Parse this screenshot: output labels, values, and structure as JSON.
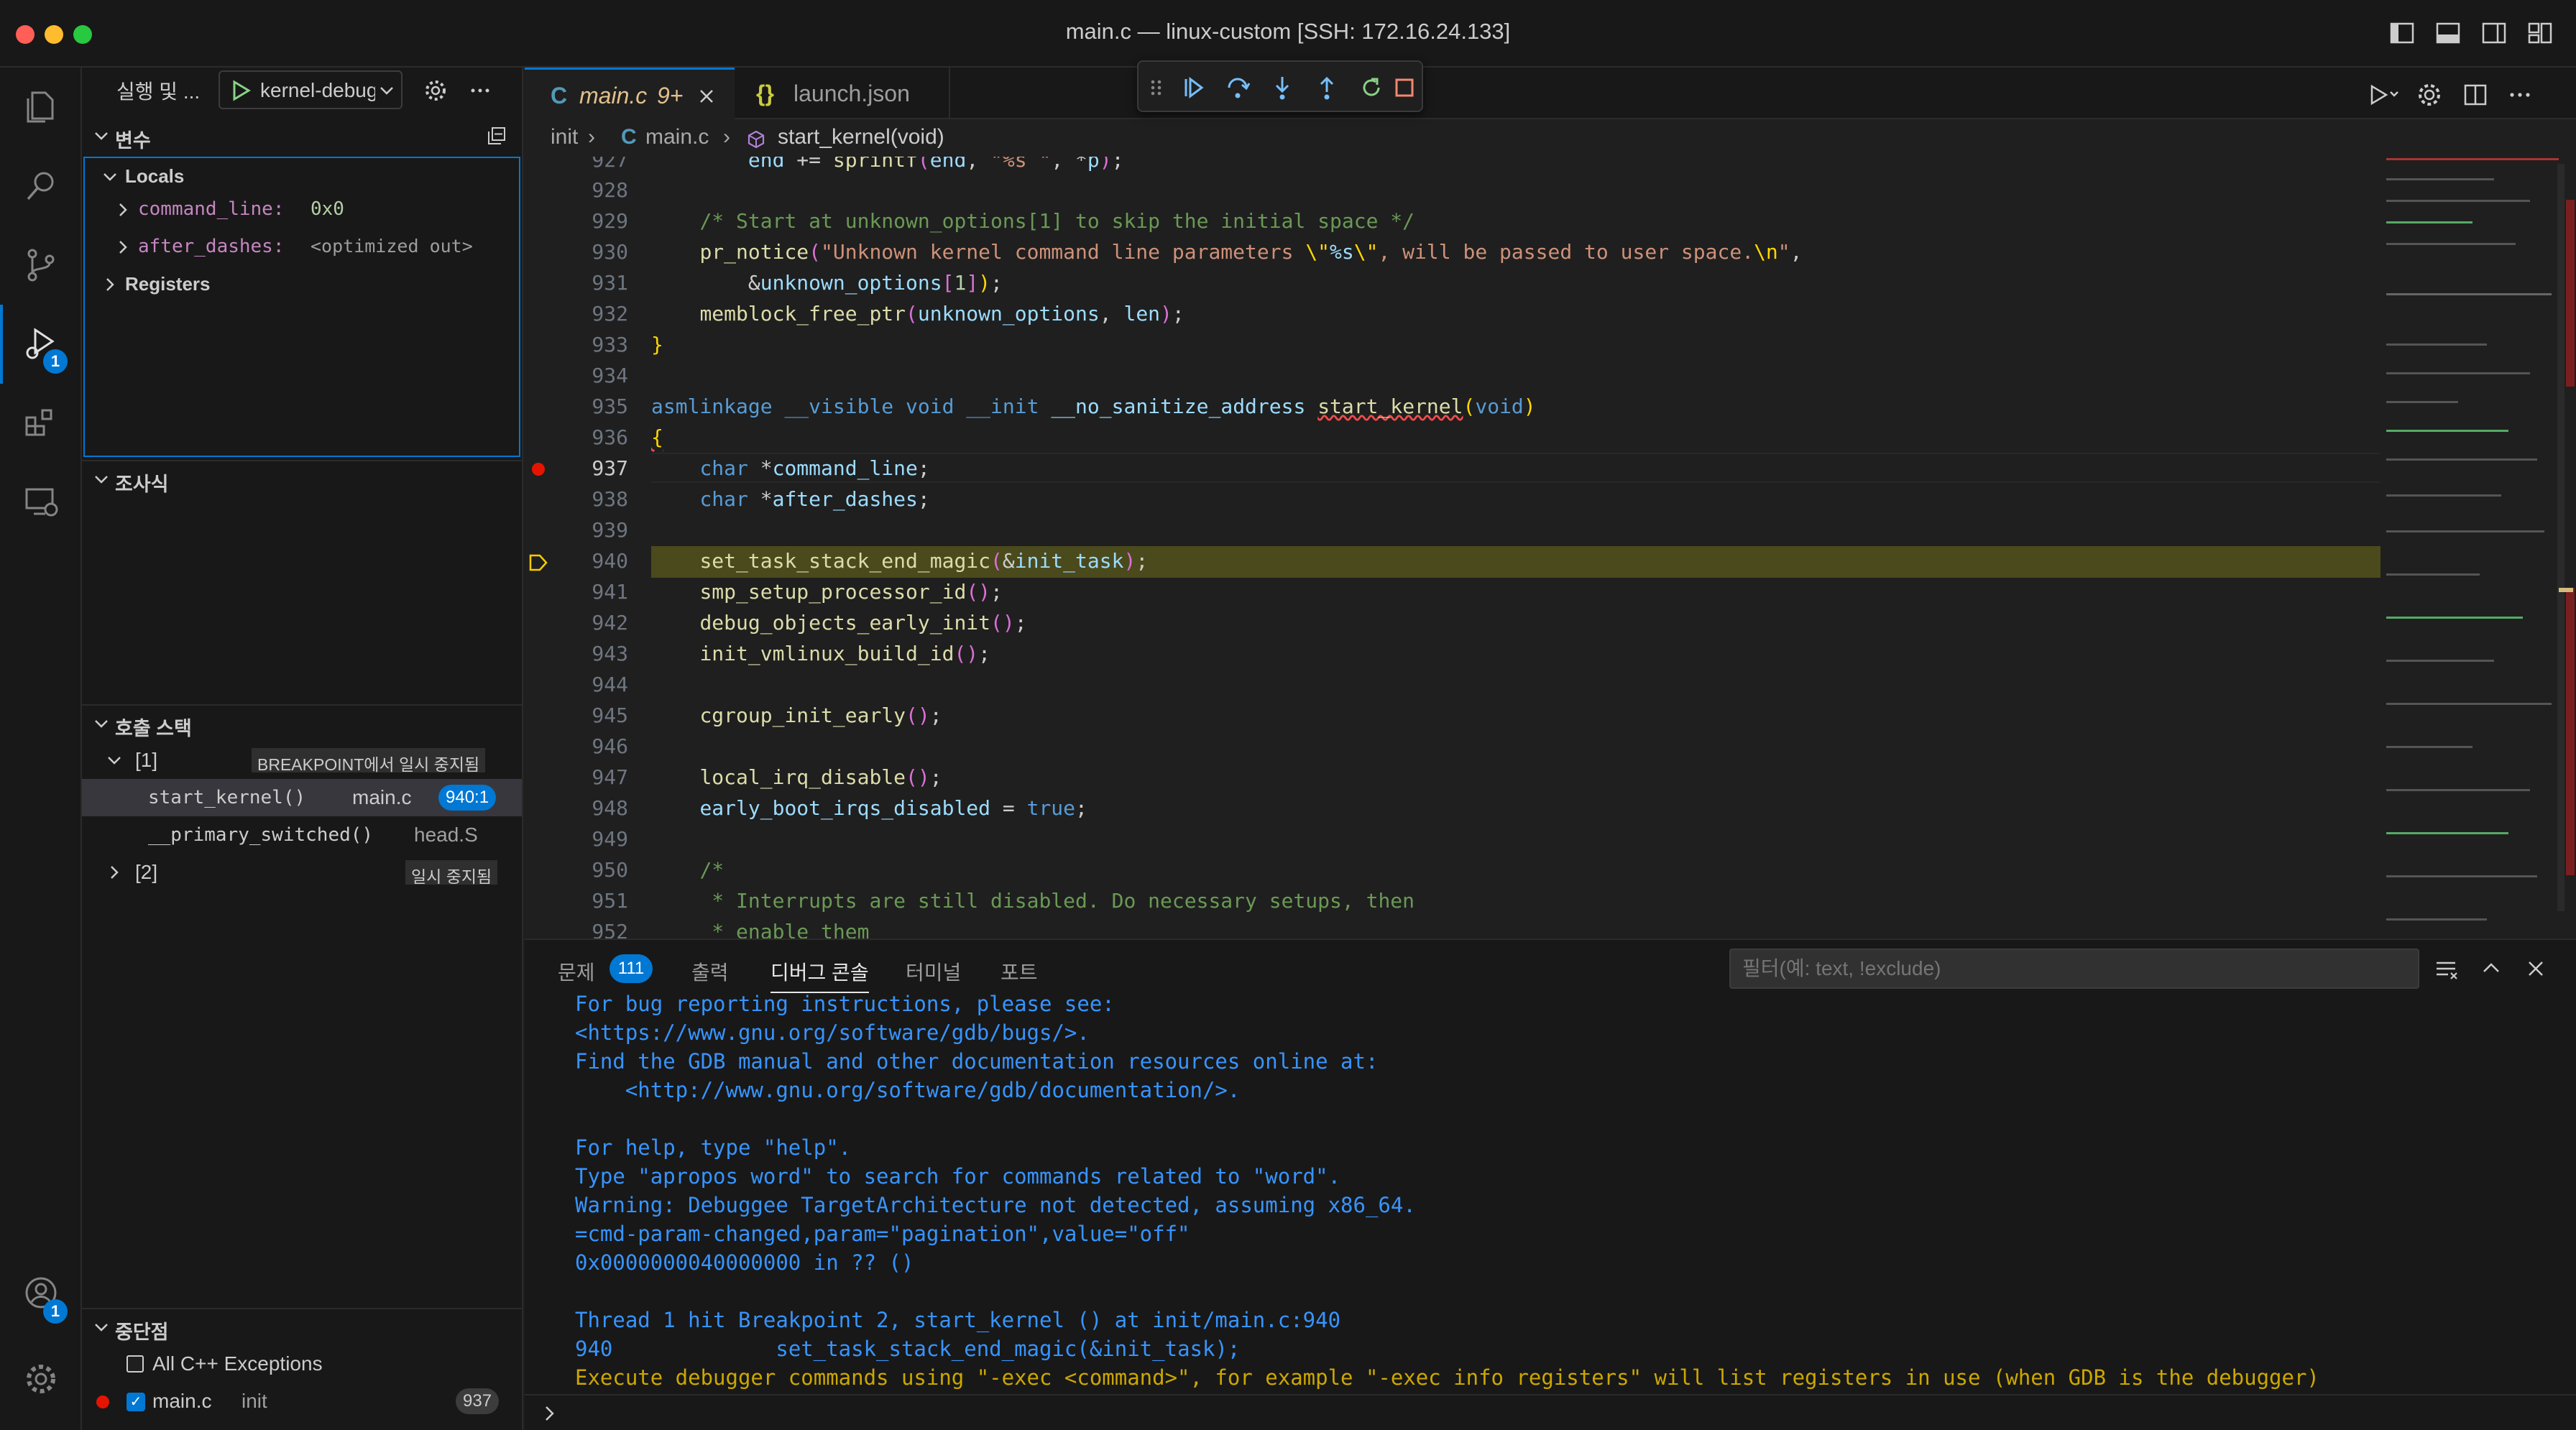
{
  "window": {
    "title": "main.c — linux-custom [SSH: 172.16.24.133]"
  },
  "sidebar": {
    "title": "실행 및 ...",
    "run_config": "kernel-debug",
    "sections": {
      "variables": "변수",
      "watch": "조사식",
      "callstack": "호출 스택",
      "breakpoints": "중단점"
    },
    "locals_label": "Locals",
    "variables": [
      {
        "name": "command_line:",
        "value": "0x0"
      },
      {
        "name": "after_dashes:",
        "value": "<optimized out>"
      }
    ],
    "registers_label": "Registers",
    "callstack": {
      "thread1": {
        "label": "[1]",
        "status": "BREAKPOINT에서 일시 중지됨"
      },
      "frames": [
        {
          "fn": "start_kernel()",
          "file": "main.c",
          "pos": "940:1"
        },
        {
          "fn": "__primary_switched()",
          "file": "head.S"
        }
      ],
      "thread2": {
        "label": "[2]",
        "status": "일시 중지됨"
      }
    },
    "breakpoints": {
      "exceptions": "All C++ Exceptions",
      "file": "main.c",
      "dir": "init",
      "line": "937"
    }
  },
  "activity": {
    "debug_badge": "1",
    "accounts_badge": "1"
  },
  "tabs": [
    {
      "label": "main.c",
      "mod": "9+",
      "icon": "C"
    },
    {
      "label": "launch.json",
      "icon": "{}"
    }
  ],
  "breadcrumb": {
    "folder": "init",
    "file": "main.c",
    "symbol": "start_kernel(void)"
  },
  "editor": {
    "line_numbers": [
      "927",
      "928",
      "929",
      "930",
      "931",
      "932",
      "933",
      "934",
      "935",
      "936",
      "937",
      "938",
      "939",
      "940",
      "941",
      "942",
      "943",
      "944",
      "945",
      "946",
      "947",
      "948",
      "949",
      "950",
      "951",
      "952"
    ],
    "current_line": "937",
    "paused_line": "940"
  },
  "panel": {
    "tabs": {
      "problems": "문제",
      "output": "출력",
      "debug_console": "디버그 콘솔",
      "terminal": "터미널",
      "ports": "포트"
    },
    "problems_count": "111",
    "filter_placeholder": "필터(예: text, !exclude)",
    "lines": [
      "For bug reporting instructions, please see:",
      "<https://www.gnu.org/software/gdb/bugs/>.",
      "Find the GDB manual and other documentation resources online at:",
      "    <http://www.gnu.org/software/gdb/documentation/>.",
      "",
      "For help, type \"help\".",
      "Type \"apropos word\" to search for commands related to \"word\".",
      "Warning: Debuggee TargetArchitecture not detected, assuming x86_64.",
      "=cmd-param-changed,param=\"pagination\",value=\"off\"",
      "0x0000000040000000 in ?? ()",
      "",
      "Thread 1 hit Breakpoint 2, start_kernel () at init/main.c:940",
      "940\t\tset_task_stack_end_magic(&init_task);"
    ],
    "warn_line": "Execute debugger commands using \"-exec <command>\", for example \"-exec info registers\" will list registers in use (when GDB is the debugger)"
  },
  "colors": {
    "accent": "#0078d4",
    "breakpoint": "#e51400",
    "paused_bg": "#4b4a1c",
    "paused_arrow": "#ffcc00"
  }
}
